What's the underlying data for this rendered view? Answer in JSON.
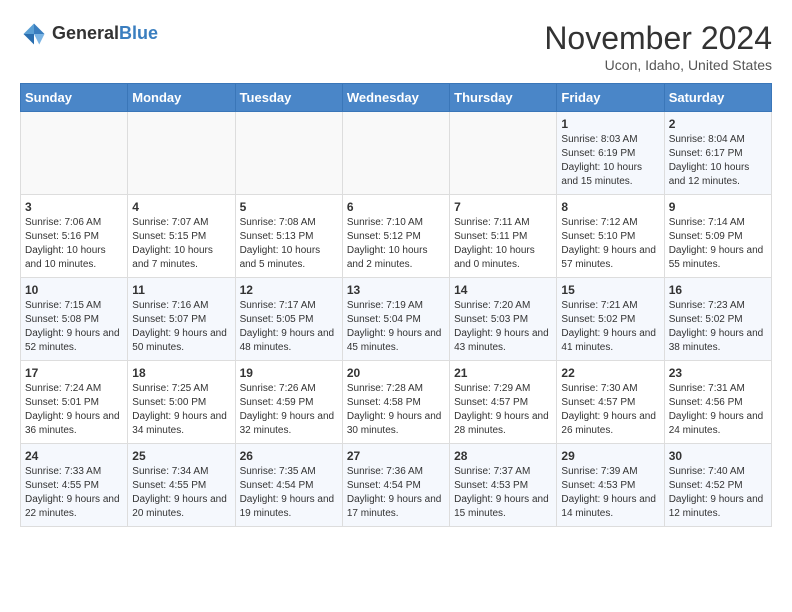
{
  "header": {
    "logo_general": "General",
    "logo_blue": "Blue",
    "month_title": "November 2024",
    "location": "Ucon, Idaho, United States"
  },
  "weekdays": [
    "Sunday",
    "Monday",
    "Tuesday",
    "Wednesday",
    "Thursday",
    "Friday",
    "Saturday"
  ],
  "weeks": [
    [
      {
        "day": "",
        "info": ""
      },
      {
        "day": "",
        "info": ""
      },
      {
        "day": "",
        "info": ""
      },
      {
        "day": "",
        "info": ""
      },
      {
        "day": "",
        "info": ""
      },
      {
        "day": "1",
        "info": "Sunrise: 8:03 AM\nSunset: 6:19 PM\nDaylight: 10 hours and 15 minutes."
      },
      {
        "day": "2",
        "info": "Sunrise: 8:04 AM\nSunset: 6:17 PM\nDaylight: 10 hours and 12 minutes."
      }
    ],
    [
      {
        "day": "3",
        "info": "Sunrise: 7:06 AM\nSunset: 5:16 PM\nDaylight: 10 hours and 10 minutes."
      },
      {
        "day": "4",
        "info": "Sunrise: 7:07 AM\nSunset: 5:15 PM\nDaylight: 10 hours and 7 minutes."
      },
      {
        "day": "5",
        "info": "Sunrise: 7:08 AM\nSunset: 5:13 PM\nDaylight: 10 hours and 5 minutes."
      },
      {
        "day": "6",
        "info": "Sunrise: 7:10 AM\nSunset: 5:12 PM\nDaylight: 10 hours and 2 minutes."
      },
      {
        "day": "7",
        "info": "Sunrise: 7:11 AM\nSunset: 5:11 PM\nDaylight: 10 hours and 0 minutes."
      },
      {
        "day": "8",
        "info": "Sunrise: 7:12 AM\nSunset: 5:10 PM\nDaylight: 9 hours and 57 minutes."
      },
      {
        "day": "9",
        "info": "Sunrise: 7:14 AM\nSunset: 5:09 PM\nDaylight: 9 hours and 55 minutes."
      }
    ],
    [
      {
        "day": "10",
        "info": "Sunrise: 7:15 AM\nSunset: 5:08 PM\nDaylight: 9 hours and 52 minutes."
      },
      {
        "day": "11",
        "info": "Sunrise: 7:16 AM\nSunset: 5:07 PM\nDaylight: 9 hours and 50 minutes."
      },
      {
        "day": "12",
        "info": "Sunrise: 7:17 AM\nSunset: 5:05 PM\nDaylight: 9 hours and 48 minutes."
      },
      {
        "day": "13",
        "info": "Sunrise: 7:19 AM\nSunset: 5:04 PM\nDaylight: 9 hours and 45 minutes."
      },
      {
        "day": "14",
        "info": "Sunrise: 7:20 AM\nSunset: 5:03 PM\nDaylight: 9 hours and 43 minutes."
      },
      {
        "day": "15",
        "info": "Sunrise: 7:21 AM\nSunset: 5:02 PM\nDaylight: 9 hours and 41 minutes."
      },
      {
        "day": "16",
        "info": "Sunrise: 7:23 AM\nSunset: 5:02 PM\nDaylight: 9 hours and 38 minutes."
      }
    ],
    [
      {
        "day": "17",
        "info": "Sunrise: 7:24 AM\nSunset: 5:01 PM\nDaylight: 9 hours and 36 minutes."
      },
      {
        "day": "18",
        "info": "Sunrise: 7:25 AM\nSunset: 5:00 PM\nDaylight: 9 hours and 34 minutes."
      },
      {
        "day": "19",
        "info": "Sunrise: 7:26 AM\nSunset: 4:59 PM\nDaylight: 9 hours and 32 minutes."
      },
      {
        "day": "20",
        "info": "Sunrise: 7:28 AM\nSunset: 4:58 PM\nDaylight: 9 hours and 30 minutes."
      },
      {
        "day": "21",
        "info": "Sunrise: 7:29 AM\nSunset: 4:57 PM\nDaylight: 9 hours and 28 minutes."
      },
      {
        "day": "22",
        "info": "Sunrise: 7:30 AM\nSunset: 4:57 PM\nDaylight: 9 hours and 26 minutes."
      },
      {
        "day": "23",
        "info": "Sunrise: 7:31 AM\nSunset: 4:56 PM\nDaylight: 9 hours and 24 minutes."
      }
    ],
    [
      {
        "day": "24",
        "info": "Sunrise: 7:33 AM\nSunset: 4:55 PM\nDaylight: 9 hours and 22 minutes."
      },
      {
        "day": "25",
        "info": "Sunrise: 7:34 AM\nSunset: 4:55 PM\nDaylight: 9 hours and 20 minutes."
      },
      {
        "day": "26",
        "info": "Sunrise: 7:35 AM\nSunset: 4:54 PM\nDaylight: 9 hours and 19 minutes."
      },
      {
        "day": "27",
        "info": "Sunrise: 7:36 AM\nSunset: 4:54 PM\nDaylight: 9 hours and 17 minutes."
      },
      {
        "day": "28",
        "info": "Sunrise: 7:37 AM\nSunset: 4:53 PM\nDaylight: 9 hours and 15 minutes."
      },
      {
        "day": "29",
        "info": "Sunrise: 7:39 AM\nSunset: 4:53 PM\nDaylight: 9 hours and 14 minutes."
      },
      {
        "day": "30",
        "info": "Sunrise: 7:40 AM\nSunset: 4:52 PM\nDaylight: 9 hours and 12 minutes."
      }
    ]
  ]
}
